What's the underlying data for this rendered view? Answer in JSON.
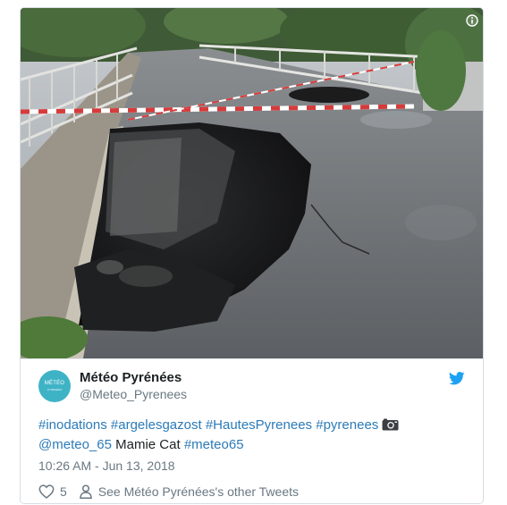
{
  "tweet": {
    "author_name": "Météo Pyrénées",
    "author_handle": "@Meteo_Pyrenees",
    "avatar_text": "MÉTÉO",
    "avatar_sub": "PYRÉNÉES",
    "hashtags_line1": [
      "#inodations",
      "#argelesgazost",
      "#HautesPyrenees",
      "#pyrenees"
    ],
    "mention": "@meteo_65",
    "plain_text": "Mamie Cat",
    "hashtag_line2": "#meteo65",
    "timestamp": "10:26 AM - Jun 13, 2018",
    "like_count": "5",
    "other_tweets_label": "See Météo Pyrénées's other Tweets"
  },
  "colors": {
    "link": "#2b7bb9",
    "twitter_blue": "#1da1f2",
    "muted": "#697882",
    "text": "#1c2022"
  },
  "icons": {
    "info": "info-icon",
    "bird": "twitter-bird-icon",
    "camera": "camera-icon",
    "heart": "heart-icon",
    "person": "person-icon"
  }
}
